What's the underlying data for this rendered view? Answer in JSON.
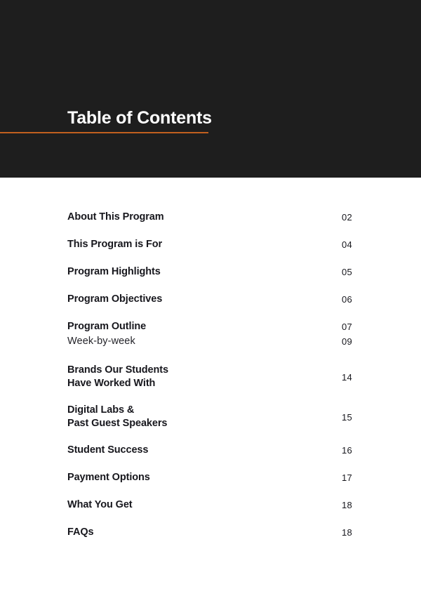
{
  "header": {
    "title": "Table of Contents",
    "background_color": "#1e1e1e",
    "rule_color": "#c1601f",
    "title_color": "#ffffff"
  },
  "toc": {
    "text_color": "#17171d",
    "entries": [
      {
        "label": "About This Program",
        "page": "02",
        "style": "bold",
        "lines": 1
      },
      {
        "label": "This Program is For",
        "page": "04",
        "style": "bold",
        "lines": 1
      },
      {
        "label": "Program Highlights",
        "page": "05",
        "style": "bold",
        "lines": 1
      },
      {
        "label": "Program Objectives",
        "page": "06",
        "style": "bold",
        "lines": 1
      },
      {
        "label": "Program Outline",
        "page": "07",
        "style": "bold",
        "lines": 1
      },
      {
        "label": "Week-by-week",
        "page": "09",
        "style": "regular",
        "lines": 1
      },
      {
        "label": "Brands Our Students\nHave Worked With",
        "page": "14",
        "style": "bold",
        "lines": 2
      },
      {
        "label": "Digital Labs &\nPast Guest Speakers",
        "page": "15",
        "style": "bold",
        "lines": 2
      },
      {
        "label": "Student Success",
        "page": "16",
        "style": "bold",
        "lines": 1
      },
      {
        "label": "Payment Options",
        "page": "17",
        "style": "bold",
        "lines": 1
      },
      {
        "label": "What You Get",
        "page": "18",
        "style": "bold",
        "lines": 1
      },
      {
        "label": "FAQs",
        "page": "18",
        "style": "bold",
        "lines": 1
      }
    ]
  }
}
